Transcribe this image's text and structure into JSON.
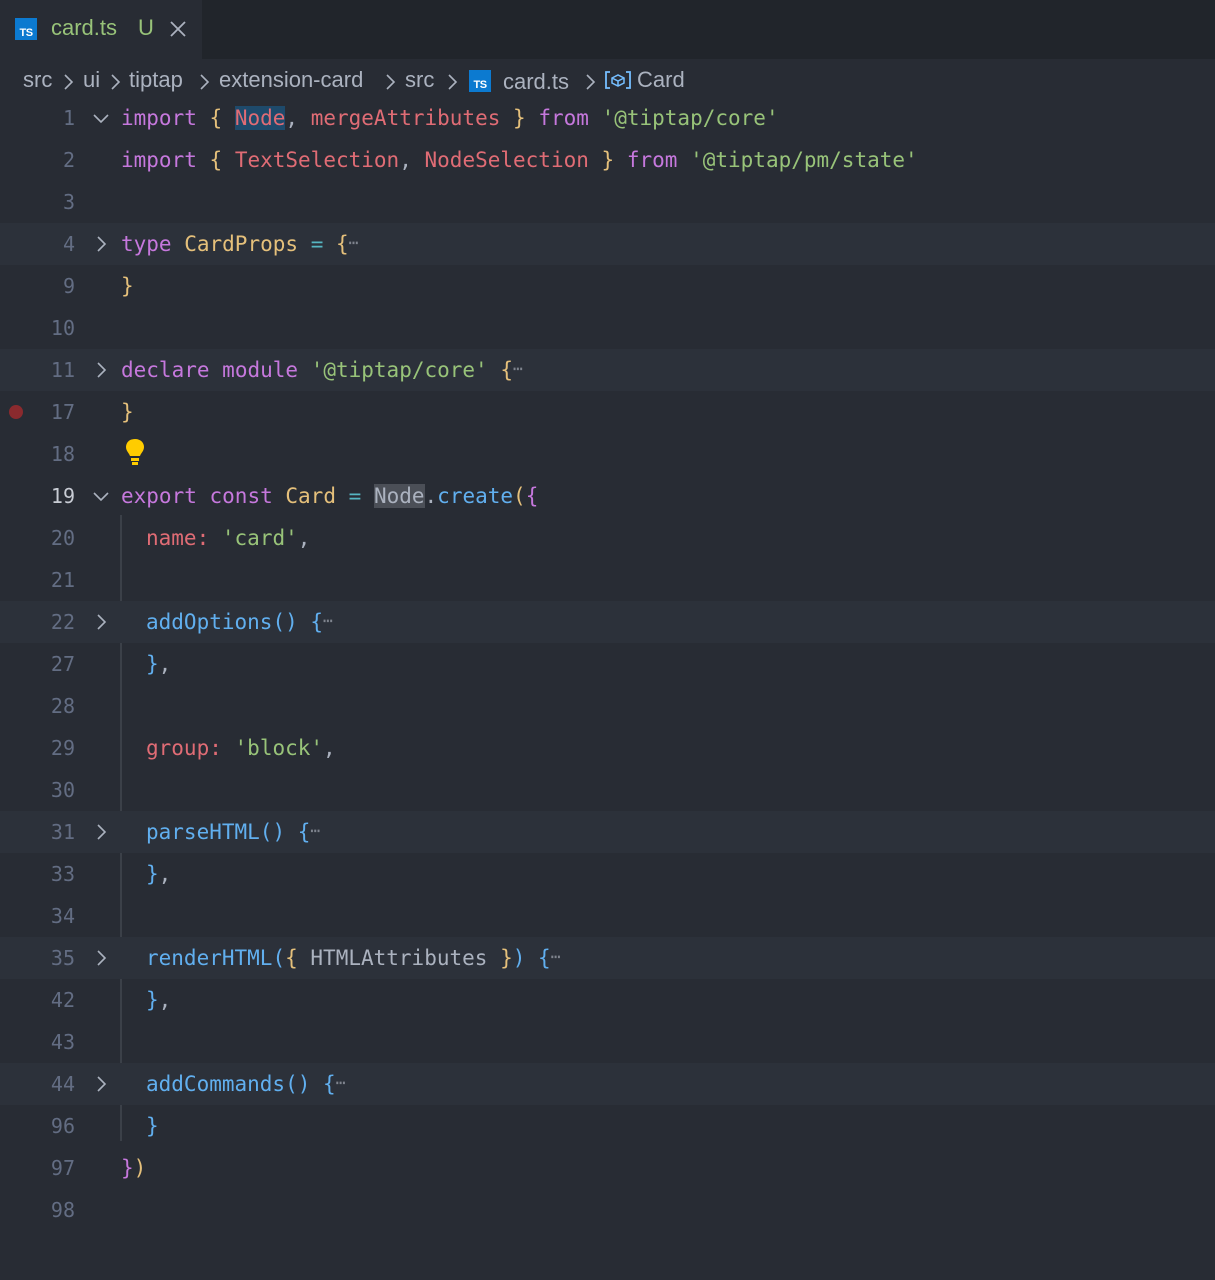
{
  "tab": {
    "icon": "typescript-file-icon",
    "icon_text": "TS",
    "title": "card.ts",
    "status": "U"
  },
  "breadcrumb": {
    "items": [
      "src",
      "ui",
      "tiptap",
      "extension-card",
      "src"
    ],
    "file": "card.ts",
    "symbol": "Card"
  },
  "colors": {
    "background": "#282c34",
    "tab_title": "#98c379",
    "breakpoint": "#8b2a2e",
    "keyword": "#c678dd",
    "string": "#98c379",
    "function": "#61afef"
  },
  "editor": {
    "active_line": "19",
    "lines": [
      {
        "num": "1",
        "t": [
          "import",
          "{",
          "Node",
          ",",
          "mergeAttributes",
          "}",
          "from",
          "'@tiptap/core'"
        ]
      },
      {
        "num": "2",
        "t": [
          "import",
          "{",
          "TextSelection",
          ",",
          "NodeSelection",
          "}",
          "from",
          "'@tiptap/pm/state'"
        ]
      },
      {
        "num": "3",
        "t": []
      },
      {
        "num": "4",
        "t": [
          "type",
          "CardProps",
          "=",
          "{",
          "⋯"
        ]
      },
      {
        "num": "9",
        "t": [
          "}"
        ]
      },
      {
        "num": "10",
        "t": []
      },
      {
        "num": "11",
        "t": [
          "declare",
          "module",
          "'@tiptap/core'",
          "{",
          "⋯"
        ]
      },
      {
        "num": "17",
        "t": [
          "}"
        ]
      },
      {
        "num": "18",
        "t": []
      },
      {
        "num": "19",
        "t": [
          "export",
          "const",
          "Card",
          "=",
          "Node",
          ".",
          "create",
          "(",
          "{"
        ]
      },
      {
        "num": "20",
        "t": [
          "name",
          ":",
          "'card'",
          ","
        ]
      },
      {
        "num": "21",
        "t": []
      },
      {
        "num": "22",
        "t": [
          "addOptions",
          "()",
          "{",
          "⋯"
        ]
      },
      {
        "num": "27",
        "t": [
          "}",
          ","
        ]
      },
      {
        "num": "28",
        "t": []
      },
      {
        "num": "29",
        "t": [
          "group",
          ":",
          "'block'",
          ","
        ]
      },
      {
        "num": "30",
        "t": []
      },
      {
        "num": "31",
        "t": [
          "parseHTML",
          "()",
          "{",
          "⋯"
        ]
      },
      {
        "num": "33",
        "t": [
          "}",
          ","
        ]
      },
      {
        "num": "34",
        "t": []
      },
      {
        "num": "35",
        "t": [
          "renderHTML",
          "(",
          "{",
          "HTMLAttributes",
          "}",
          ")",
          "{",
          "⋯"
        ]
      },
      {
        "num": "42",
        "t": [
          "}",
          ","
        ]
      },
      {
        "num": "43",
        "t": []
      },
      {
        "num": "44",
        "t": [
          "addCommands",
          "()",
          "{",
          "⋯"
        ]
      },
      {
        "num": "96",
        "t": [
          "}"
        ]
      },
      {
        "num": "97",
        "t": [
          "}",
          ")"
        ]
      },
      {
        "num": "98",
        "t": []
      }
    ]
  }
}
